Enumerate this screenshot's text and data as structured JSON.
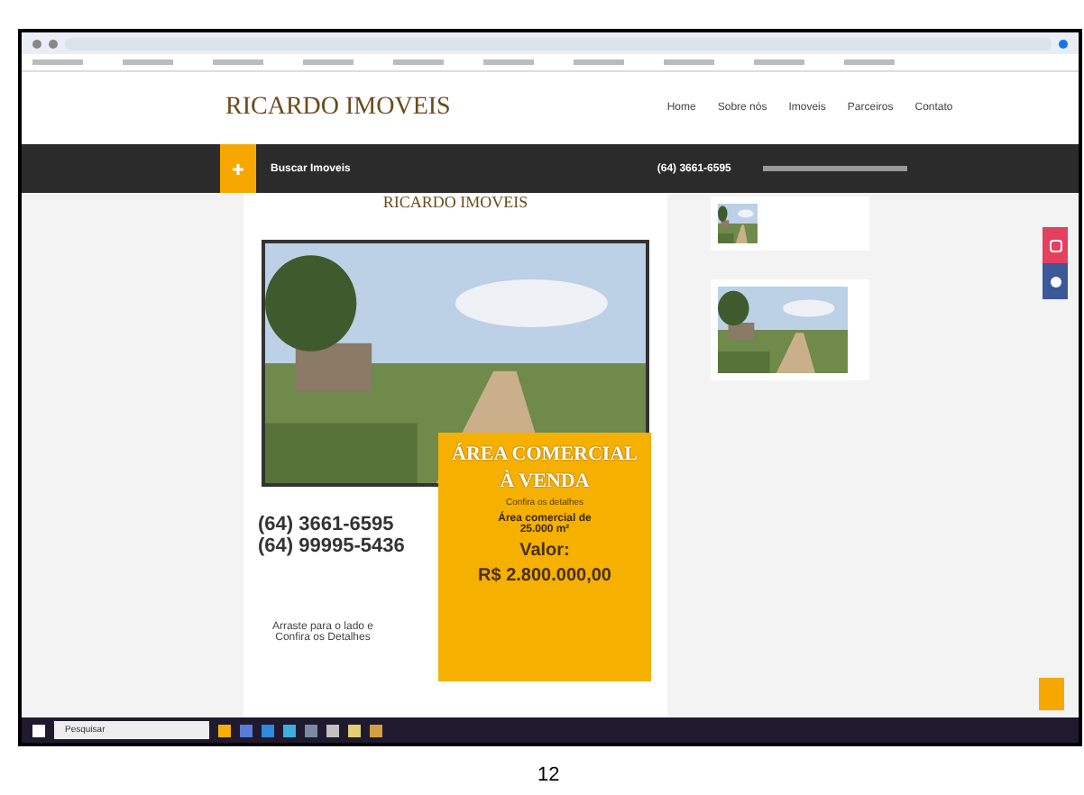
{
  "site": {
    "logo": "RICARDO IMOVEIS",
    "nav": [
      {
        "label": "Home"
      },
      {
        "label": "Sobre nós"
      },
      {
        "label": "Imoveis"
      },
      {
        "label": "Parceiros"
      },
      {
        "label": "Contato"
      }
    ]
  },
  "top_bar": {
    "search_label": "Buscar Imoveis",
    "phone": "(64) 3661-6595"
  },
  "flyer": {
    "logo": "RICARDO IMOVEIS",
    "headline": "ÁREA COMERCIAL",
    "subheadline": "À VENDA",
    "note": "Confira os detalhes",
    "area": "Área comercial de 25.000 m²",
    "value_label": "Valor:",
    "value": "R$ 2.800.000,00",
    "phones": [
      "(64) 3661-6595",
      "(64) 99995-5436"
    ],
    "drag_hint": "Arraste para o lado e Confira os Detalhes"
  },
  "taskbar": {
    "search_placeholder": "Pesquisar"
  },
  "page_number": "12"
}
